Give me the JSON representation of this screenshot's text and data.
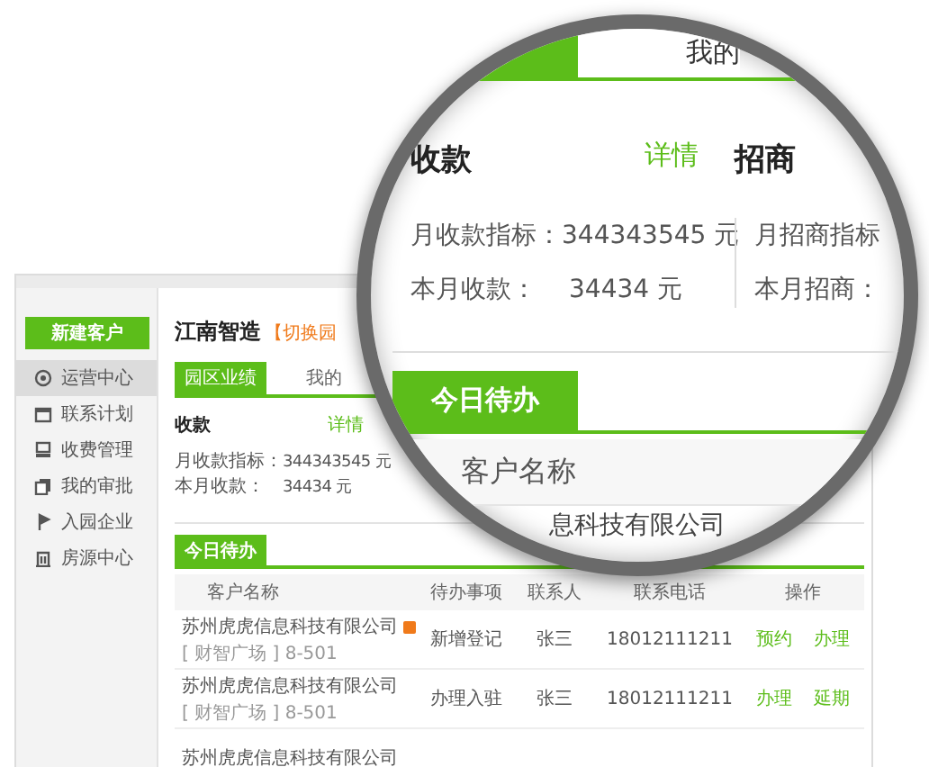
{
  "sidebar": {
    "new_button": "新建客户",
    "items": [
      {
        "label": "运营中心",
        "selected": true
      },
      {
        "label": "联系计划",
        "selected": false
      },
      {
        "label": "收费管理",
        "selected": false
      },
      {
        "label": "我的审批",
        "selected": false
      },
      {
        "label": "入园企业",
        "selected": false
      },
      {
        "label": "房源中心",
        "selected": false
      }
    ]
  },
  "header": {
    "title": "江南智造",
    "switch_link": "【切换园"
  },
  "tabs": [
    {
      "label": "园区业绩",
      "selected": true
    },
    {
      "label": "我的",
      "selected": false
    }
  ],
  "revenue": {
    "title": "收款",
    "detail_link": "详情",
    "rows": [
      {
        "label": "月收款指标：",
        "value": "344343545 元"
      },
      {
        "label": "本月收款：",
        "value": "34434 元"
      }
    ]
  },
  "todo": {
    "tab": "今日待办",
    "columns": [
      "客户名称",
      "待办事项",
      "联系人",
      "联系电话",
      "操作"
    ],
    "rows": [
      {
        "company": "苏州虎虎信息科技有限公司",
        "flagged": true,
        "location": "[ 财智广场 ] 8-501",
        "task": "新增登记",
        "contact": "张三",
        "phone": "18012111211",
        "actions": [
          "预约",
          "办理"
        ]
      },
      {
        "company": "苏州虎虎信息科技有限公司",
        "flagged": false,
        "location": "[ 财智广场 ] 8-501",
        "task": "办理入驻",
        "contact": "张三",
        "phone": "18012111211",
        "actions": [
          "办理",
          "延期"
        ]
      },
      {
        "company": "苏州虎虎信息科技有限公司",
        "flagged": false
      }
    ]
  },
  "magnifier": {
    "tabs": [
      {
        "selected": true
      },
      {
        "label": "我的",
        "selected": false
      }
    ],
    "revenue": {
      "title": "收款",
      "detail_link": "详情",
      "rows": [
        {
          "label": "月收款指标：",
          "value": "344343545 元"
        },
        {
          "label": "本月收款：",
          "value": "34434 元"
        }
      ]
    },
    "investment": {
      "title": "招商",
      "rows": [
        "月招商指标",
        "本月招商："
      ]
    },
    "todo_tab": "今日待办",
    "column": "客户名称",
    "partial_row": "息科技有限公司"
  }
}
